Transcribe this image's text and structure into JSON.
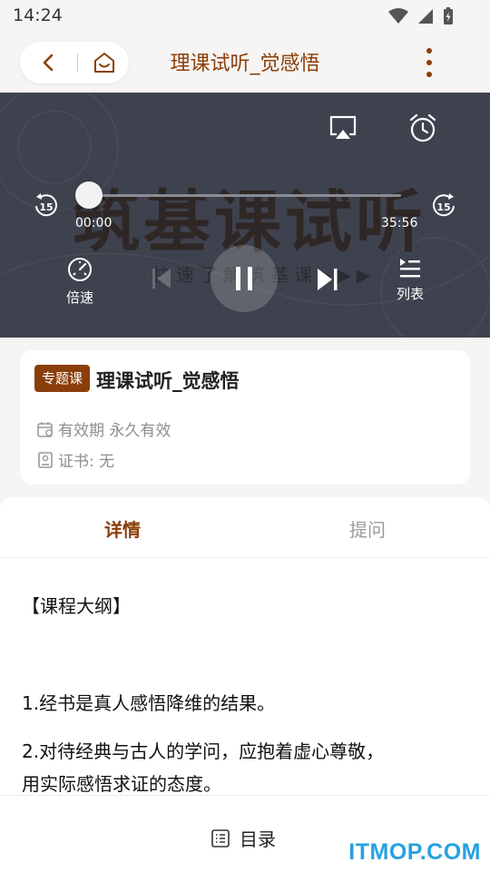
{
  "status_bar": {
    "time": "14:24"
  },
  "header": {
    "title": "理课试听_觉感悟"
  },
  "player": {
    "background_text": "筑基课试听",
    "background_subtitle": "快速了解筑基课▶▶▶",
    "current_time": "00:00",
    "duration": "35:56",
    "progress": 0,
    "rewind_seconds": "15",
    "forward_seconds": "15",
    "speed_label": "倍速",
    "list_label": "列表"
  },
  "course": {
    "badge": "专题课",
    "title": "理课试听_觉感悟",
    "validity": "有效期 永久有效",
    "certificate": "证书: 无"
  },
  "tabs": [
    {
      "label": "详情",
      "active": true
    },
    {
      "label": "提问",
      "active": false
    }
  ],
  "details": {
    "heading": "【课程大纲】",
    "lines": [
      "1.经书是真人感悟降维的结果。",
      "2.对待经典与古人的学问，应抱着虚心尊敬，",
      "用实际感悟求证的态度。"
    ]
  },
  "bottom_bar": {
    "toc_label": "目录"
  },
  "watermark": "ITMOP.COM",
  "colors": {
    "accent": "#8a3e0a",
    "player_bg": "#3e424e",
    "watermark": "#26a2e0"
  }
}
